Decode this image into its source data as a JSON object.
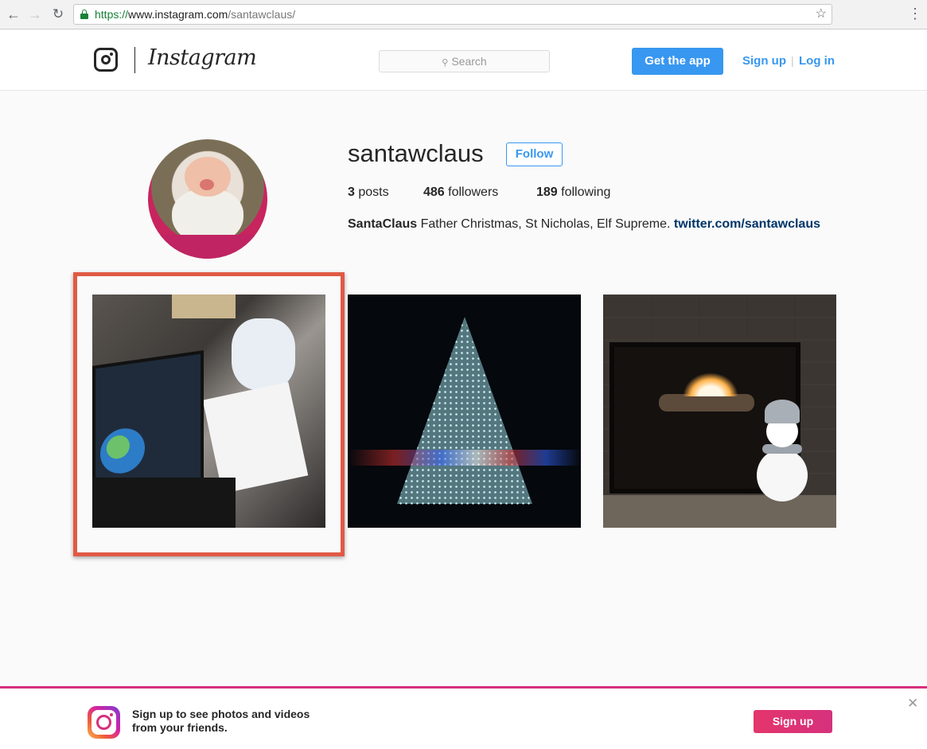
{
  "browser": {
    "url_protocol": "https://",
    "url_host": "www.instagram.com",
    "url_path": "/santawclaus/"
  },
  "header": {
    "wordmark": "Instagram",
    "search_placeholder": "Search",
    "get_app_label": "Get the app",
    "signup_label": "Sign up",
    "separator": "|",
    "login_label": "Log in"
  },
  "profile": {
    "username": "santawclaus",
    "follow_label": "Follow",
    "posts_count": "3",
    "posts_label": " posts",
    "followers_count": "486",
    "followers_label": " followers",
    "following_count": "189",
    "following_label": " following",
    "bio_name": "SantaClaus",
    "bio_text": " Father Christmas, St Nicholas, Elf Supreme. ",
    "bio_link": "twitter.com/santawclaus"
  },
  "posts": [
    {
      "subject": "desk with laptop and papers",
      "highlighted": true
    },
    {
      "subject": "lit christmas tree at night",
      "highlighted": false
    },
    {
      "subject": "fireplace with snowman",
      "highlighted": false
    }
  ],
  "banner": {
    "line1": "Sign up to see photos and videos",
    "line2": "from your friends.",
    "signup_label": "Sign up"
  },
  "colors": {
    "accent_blue": "#3897f0",
    "highlight_frame": "#e05a45",
    "banner_pink": "#d6317d",
    "link_dark_blue": "#003569"
  },
  "icons": [
    "back-arrow-icon",
    "forward-arrow-icon",
    "reload-icon",
    "lock-icon",
    "star-icon",
    "menu-dots-icon",
    "instagram-glyph-icon",
    "search-icon",
    "instagram-gradient-logo-icon",
    "close-icon"
  ]
}
